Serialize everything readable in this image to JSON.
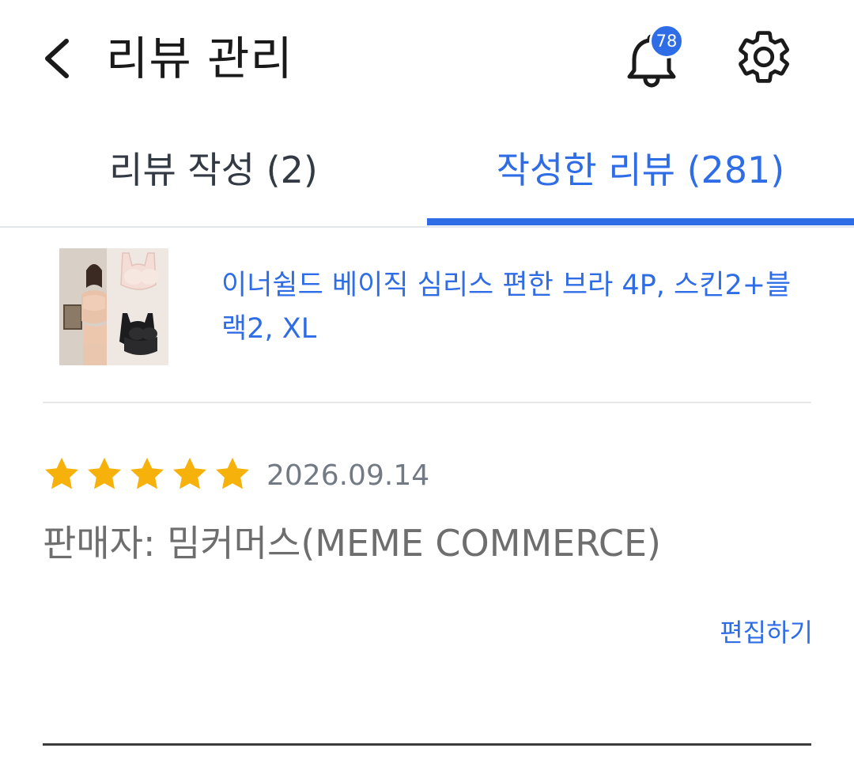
{
  "header": {
    "title": "리뷰 관리",
    "back_icon": "chevron-left-icon",
    "notification_icon": "bell-icon",
    "notification_count": "78",
    "settings_icon": "gear-icon"
  },
  "tabs": [
    {
      "label": "리뷰 작성 (2)",
      "active": false
    },
    {
      "label": "작성한 리뷰 (281)",
      "active": true
    }
  ],
  "review": {
    "product_name": "이너쉴드 베이직 심리스 편한 브라 4P, 스킨2+블랙2, XL",
    "rating": 5,
    "max_rating": 5,
    "date": "2026.09.14",
    "seller": "판매자: 밈커머스(MEME COMMERCE)",
    "edit_label": "편집하기"
  },
  "colors": {
    "accent": "#2f6de6",
    "star": "#f6b10a",
    "text_dark": "#1a1a1a",
    "text_gray": "#6e6e6e"
  }
}
